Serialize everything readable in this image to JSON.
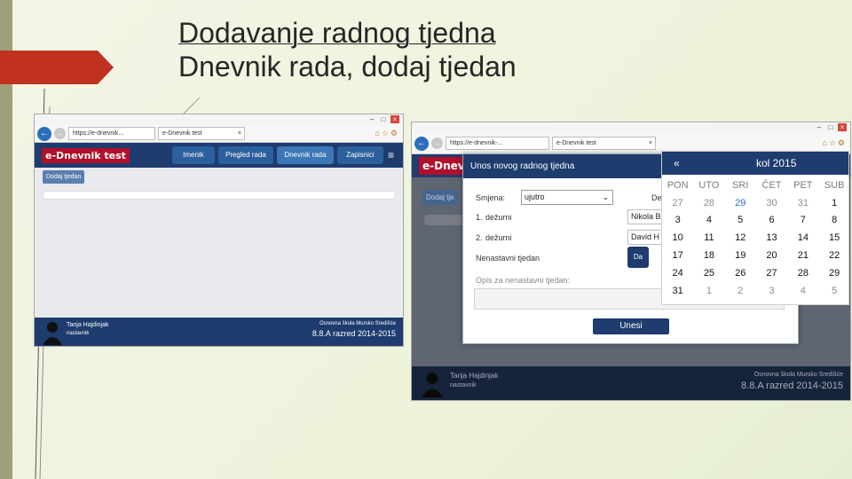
{
  "slide": {
    "title_line1": "Dodavanje radnog tjedna",
    "title_line2": "Dnevnik rada, dodaj tjedan"
  },
  "browser": {
    "url_left": "https://e-dnevnik...",
    "tab_left": "e-Dnevnik test",
    "url_right": "https://e-dnevnik-...",
    "tab_right": "e-Dnevnik test",
    "close_symbol": "×"
  },
  "app": {
    "logo": "e-Dnevnik test",
    "logo_cropped": "e-Dnev",
    "nav": [
      "Imenik",
      "Pregled rada",
      "Dnevnik rada",
      "Zapisnici"
    ],
    "menu_symbol": "≡",
    "add_week_button": "Dodaj tjedan",
    "add_week_button_cropped": "Dodaj tje"
  },
  "footer": {
    "user_name": "Tanja Hajdinjak",
    "user_role": "nastavnik",
    "school": "Osnovna škola Mursko Središće",
    "class_year": "8.8.A razred 2014-2015"
  },
  "modal": {
    "title": "Unos novog radnog tjedna",
    "shift_label": "Smjena:",
    "shift_value": "ujutro",
    "cropped_label": "De",
    "duty1_num": "1.",
    "duty1_label": "dežurni",
    "duty1_value": "Nikola B",
    "duty2_num": "2.",
    "duty2_label": "dežurni",
    "duty2_value": "David H",
    "non_teaching_label": "Nenastavni tjedan",
    "da_button": "Da",
    "description_label": "Opis za nenastavni tjedan:",
    "submit_button": "Unesi"
  },
  "calendar": {
    "prev": "«",
    "month": "kol 2015",
    "weekdays": [
      "PON",
      "UTO",
      "SRI",
      "ČET",
      "PET",
      "SUB"
    ],
    "weeks": [
      [
        "27",
        "28",
        "29",
        "30",
        "31",
        "1"
      ],
      [
        "3",
        "4",
        "5",
        "6",
        "7",
        "8"
      ],
      [
        "10",
        "11",
        "12",
        "13",
        "14",
        "15"
      ],
      [
        "17",
        "18",
        "19",
        "20",
        "21",
        "22"
      ],
      [
        "24",
        "25",
        "26",
        "27",
        "28",
        "29"
      ],
      [
        "31",
        "1",
        "2",
        "3",
        "4",
        "5"
      ]
    ]
  },
  "colors": {
    "navy": "#1e3c6e",
    "logo_red": "#b0102a",
    "accent_blue": "#2a6fbd",
    "slide_arrow": "#c0311f"
  }
}
